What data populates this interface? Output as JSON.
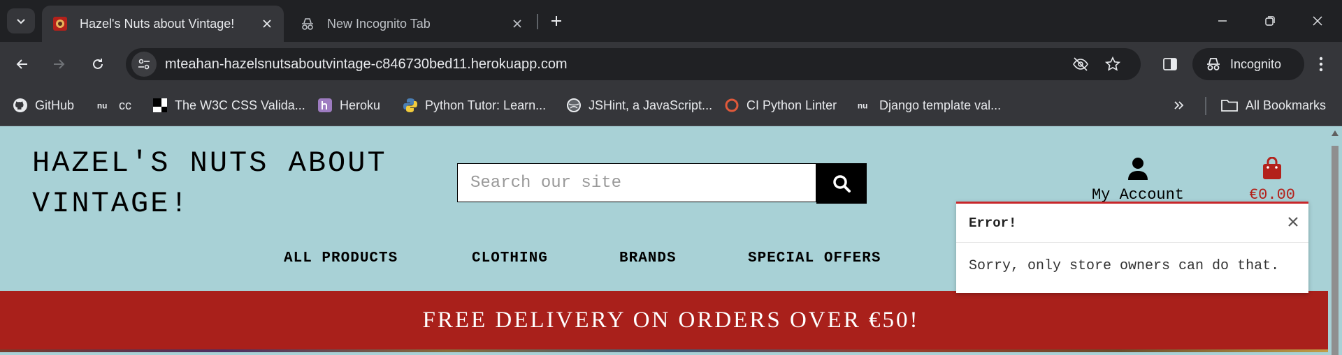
{
  "browser": {
    "tabs": [
      {
        "title": "Hazel's Nuts about Vintage!",
        "active": true
      },
      {
        "title": "New Incognito Tab",
        "active": false
      }
    ],
    "url": "mteahan-hazelsnutsaboutvintage-c846730bed11.herokuapp.com",
    "profile_label": "Incognito",
    "bookmarks": [
      {
        "label": "GitHub",
        "icon": "github-icon"
      },
      {
        "label": "cc",
        "icon": "nu-icon"
      },
      {
        "label": "The W3C CSS Valida...",
        "icon": "w3c-icon"
      },
      {
        "label": "Heroku",
        "icon": "heroku-icon"
      },
      {
        "label": "Python Tutor: Learn...",
        "icon": "python-icon"
      },
      {
        "label": "JSHint, a JavaScript...",
        "icon": "jshint-icon"
      },
      {
        "label": "CI Python Linter",
        "icon": "ci-icon"
      },
      {
        "label": "Django template val...",
        "icon": "nu-icon"
      }
    ],
    "all_bookmarks_label": "All Bookmarks"
  },
  "site": {
    "logo_line1": "HAZEL'S NUTS ABOUT",
    "logo_line2": "VINTAGE!",
    "search_placeholder": "Search our site",
    "account_label": "My Account",
    "bag_total": "€0.00",
    "nav": [
      "ALL PRODUCTS",
      "CLOTHING",
      "BRANDS",
      "SPECIAL OFFERS"
    ],
    "banner": "FREE DELIVERY ON ORDERS OVER €50!"
  },
  "toast": {
    "title": "Error!",
    "message": "Sorry, only store owners can do that."
  },
  "colors": {
    "page_bg": "#a8d1d6",
    "banner_bg": "#a9201b",
    "bag_red": "#b3211b",
    "chrome_dark": "#202124",
    "chrome_mid": "#35363a"
  }
}
